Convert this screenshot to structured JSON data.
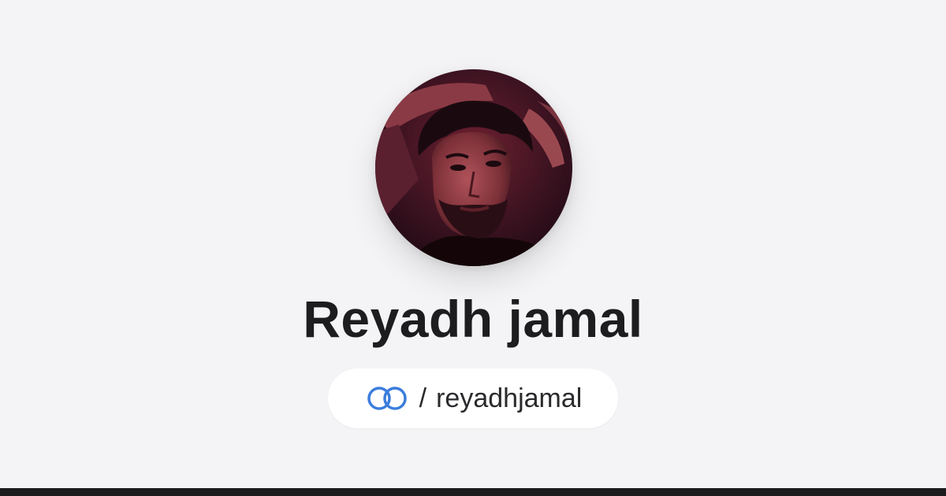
{
  "profile": {
    "name": "Reyadh jamal",
    "handle_prefix": "/",
    "handle": "reyadhjamal",
    "avatar_icon": "profile-photo"
  },
  "brand": {
    "icon": "linked-rings-icon",
    "accent_color": "#3b7ddd"
  },
  "colors": {
    "background": "#f4f4f6",
    "name_text": "#1d1d1f",
    "pill_background": "#ffffff",
    "bottom_bar": "#1b1b1d"
  }
}
